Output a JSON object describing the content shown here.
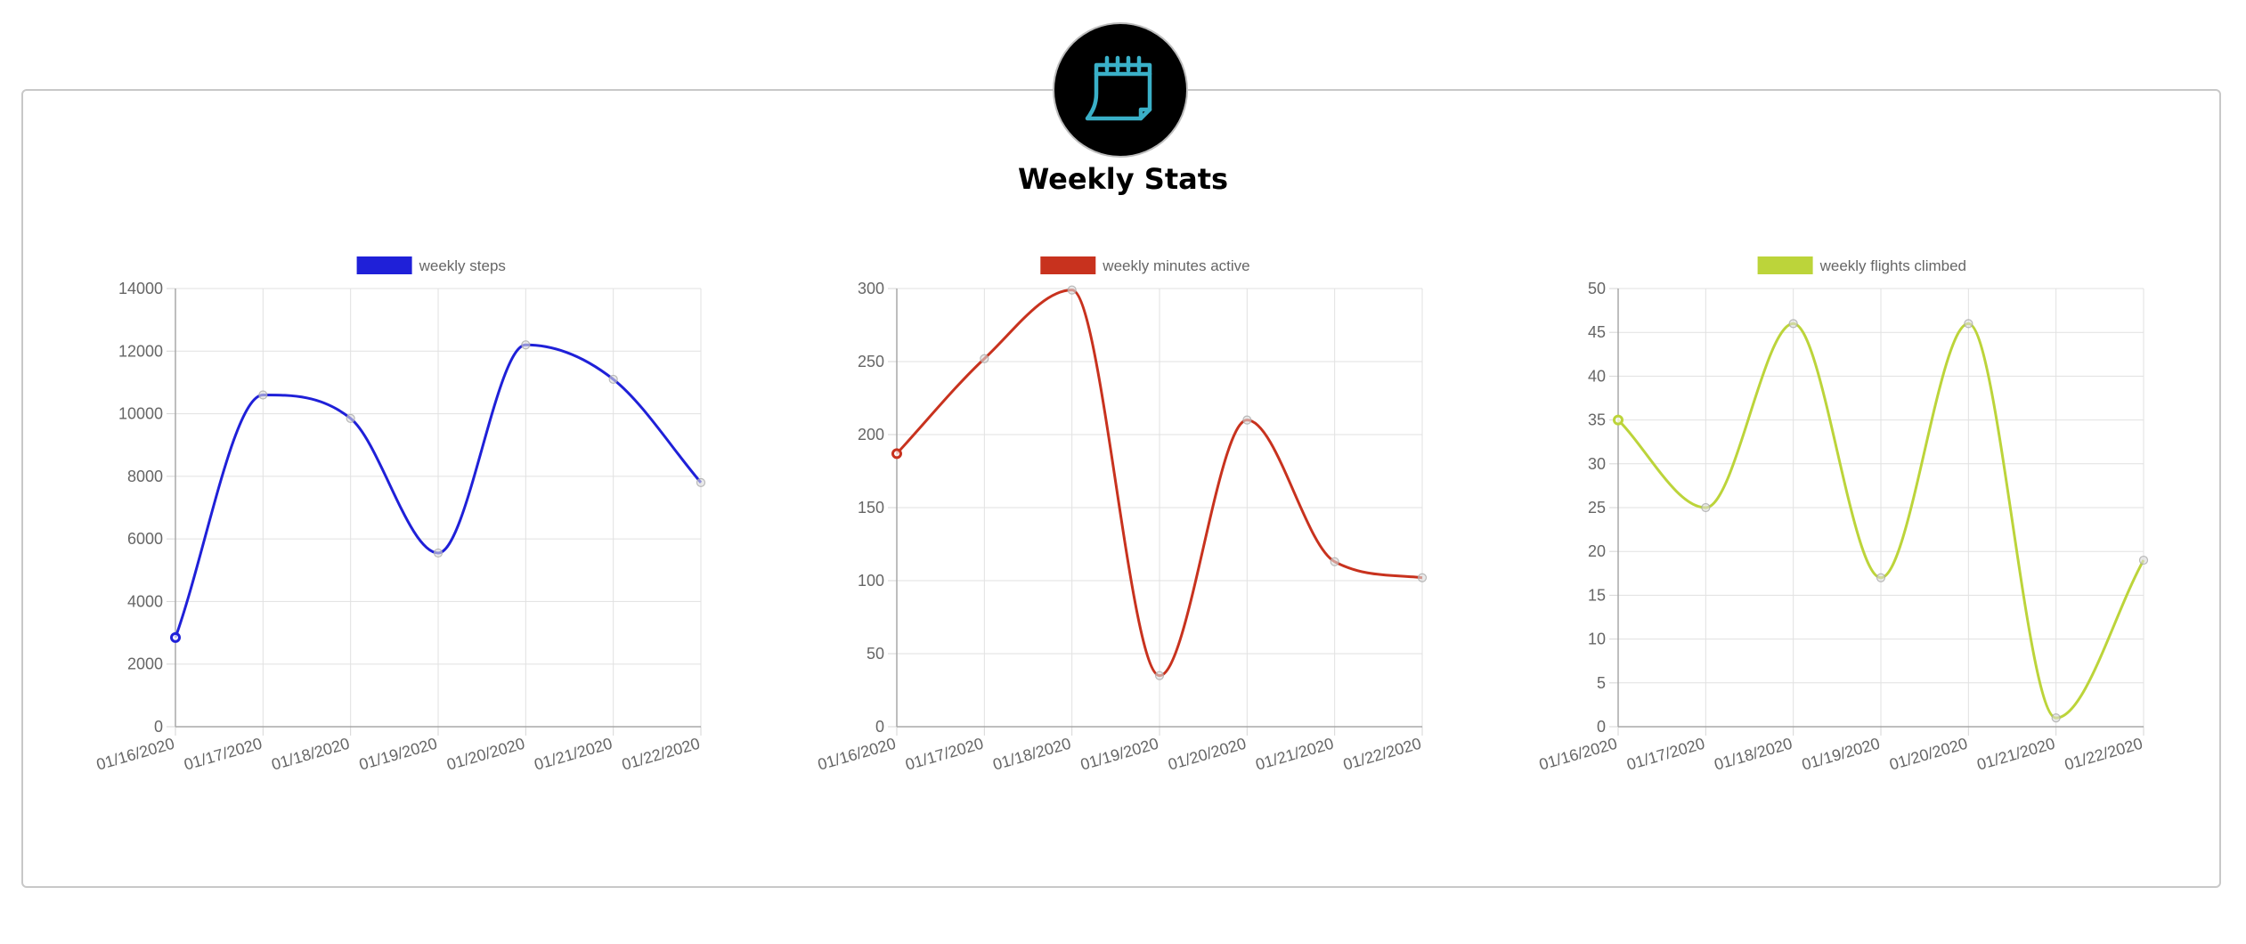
{
  "header": {
    "title": "Weekly Stats",
    "icon": "calendar-icon",
    "icon_color": "#3ab0c8"
  },
  "chart_data": [
    {
      "type": "line",
      "x": [
        "01/16/2020",
        "01/17/2020",
        "01/18/2020",
        "01/19/2020",
        "01/20/2020",
        "01/21/2020",
        "01/22/2020"
      ],
      "series": [
        {
          "name": "weekly steps",
          "values": [
            2850,
            10600,
            9850,
            5550,
            12200,
            11100,
            7800
          ],
          "color": "#1f20d8"
        }
      ],
      "ylim": [
        0,
        14000
      ],
      "yticks": [
        0,
        2000,
        4000,
        6000,
        8000,
        10000,
        12000,
        14000
      ],
      "grid": true,
      "legend": "top"
    },
    {
      "type": "line",
      "x": [
        "01/16/2020",
        "01/17/2020",
        "01/18/2020",
        "01/19/2020",
        "01/20/2020",
        "01/21/2020",
        "01/22/2020"
      ],
      "series": [
        {
          "name": "weekly minutes active",
          "values": [
            187,
            252,
            299,
            35,
            210,
            113,
            102
          ],
          "color": "#c8321e"
        }
      ],
      "ylim": [
        0,
        300
      ],
      "yticks": [
        0,
        50,
        100,
        150,
        200,
        250,
        300
      ],
      "grid": true,
      "legend": "top"
    },
    {
      "type": "line",
      "x": [
        "01/16/2020",
        "01/17/2020",
        "01/18/2020",
        "01/19/2020",
        "01/20/2020",
        "01/21/2020",
        "01/22/2020"
      ],
      "series": [
        {
          "name": "weekly flights climbed",
          "values": [
            35,
            25,
            46,
            17,
            46,
            1,
            19
          ],
          "color": "#bcd43a"
        }
      ],
      "ylim": [
        0,
        50
      ],
      "yticks": [
        0,
        5,
        10,
        15,
        20,
        25,
        30,
        35,
        40,
        45,
        50
      ],
      "grid": true,
      "legend": "top"
    }
  ]
}
